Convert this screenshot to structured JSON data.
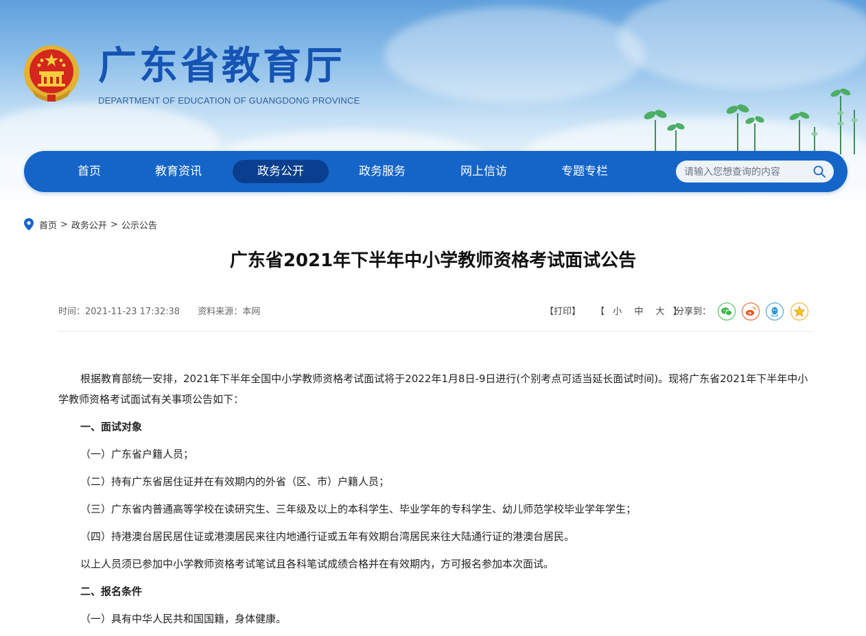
{
  "header": {
    "site_title": "广东省教育厅",
    "site_subtitle": "DEPARTMENT OF EDUCATION OF GUANGDONG PROVINCE",
    "emblem_icon": "national-emblem-icon"
  },
  "nav": {
    "items": [
      {
        "label": "首页"
      },
      {
        "label": "教育资讯"
      },
      {
        "label": "政务公开",
        "active": true
      },
      {
        "label": "政务服务"
      },
      {
        "label": "网上信访"
      },
      {
        "label": "专题专栏"
      }
    ],
    "search_placeholder": "请输入您想查询的内容",
    "accent": "#1565c8"
  },
  "breadcrumb": {
    "items": [
      "首页",
      "政务公开",
      "公示公告"
    ],
    "separator": ">"
  },
  "article": {
    "title": "广东省2021年下半年中小学教师资格考试面试公告",
    "time": "时间：2021-11-23 17:32:38",
    "source": "资料来源：本网",
    "print_label": "【打印】",
    "font_size_open": "【",
    "font_sizes": [
      "小",
      "中",
      "大"
    ],
    "font_size_close": "】",
    "share_label": "分享到：",
    "share_icons": [
      "wechat-icon",
      "weibo-icon",
      "qq-icon",
      "qzone-icon"
    ],
    "body": {
      "intro": "根据教育部统一安排，2021年下半年全国中小学教师资格考试面试将于2022年1月8日-9日进行(个别考点可适当延长面试时间)。现将广东省2021年下半年中小学教师资格考试面试有关事项公告如下：",
      "section1": "一、面试对象",
      "items": [
        "（一）广东省户籍人员；",
        "（二）持有广东省居住证并在有效期内的外省（区、市）户籍人员；",
        "（三）广东省内普通高等学校在读研究生、三年级及以上的本科学生、毕业学年的专科学生、幼儿师范学校毕业学年学生；",
        "（四）持港澳台居民居住证或港澳居民来往内地通行证或五年有效期台湾居民来往大陆通行证的港澳台居民。"
      ],
      "note": "以上人员须已参加中小学教师资格考试笔试且各科笔试成绩合格并在有效期内，方可报名参加本次面试。",
      "section2": "二、报名条件",
      "cut_line": "（一）具有中华人民共和国国籍，身体健康。"
    }
  }
}
